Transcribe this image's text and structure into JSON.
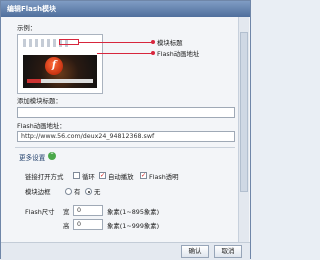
{
  "dialog": {
    "title": "编辑Flash模块"
  },
  "example": {
    "label": "示例：",
    "annotation_title": "模块标题",
    "annotation_address": "Flash动画地址",
    "flash_glyph": "f"
  },
  "fields": {
    "title_label": "添加模块标题：",
    "title_value": "",
    "address_label": "Flash动画地址：",
    "address_value": "http://www.56.com/deux24_94812368.swf"
  },
  "more": {
    "label": "更多设置"
  },
  "link_mode": {
    "label": "链接打开方式",
    "loop_label": "循环",
    "loop_checked": false,
    "autoplay_label": "自动播放",
    "autoplay_checked": true,
    "transparent_label": "Flash透明",
    "transparent_checked": true
  },
  "border": {
    "label": "模块边框",
    "yes_label": "有",
    "no_label": "无",
    "selected": "no"
  },
  "size": {
    "label": "Flash尺寸",
    "width_label": "宽",
    "width_value": "0",
    "width_unit": "象素(1~895象素)",
    "height_label": "高",
    "height_value": "0",
    "height_unit": "象素(1~999象素)"
  },
  "buttons": {
    "ok": "确认",
    "cancel": "取消"
  },
  "colors": {
    "accent_red": "#d7263d",
    "title_bar": "#5b7aa6"
  }
}
